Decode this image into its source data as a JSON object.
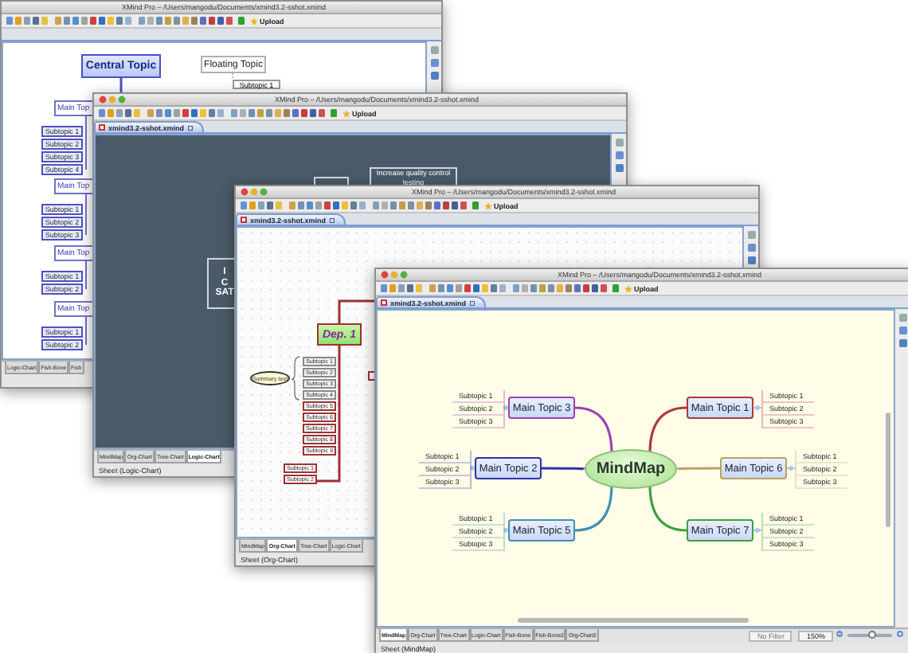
{
  "windows": [
    {
      "title": "XMind Pro – /Users/mangodu/Documents/xmind3.2-sshot.xmind",
      "upload": "Upload",
      "canvas": {
        "kind": "logic",
        "central": "Central Topic",
        "floating": "Floating Topic",
        "floating_child": "Subtopic 1",
        "branches": [
          {
            "label": "Main Top",
            "children": [
              "Subtopic 1",
              "Subtopic 2",
              "Subtopic 3",
              "Subtopic 4"
            ]
          },
          {
            "label": "Main Top",
            "children": [
              "Subtopic 1",
              "Subtopic 2",
              "Subtopic 3"
            ]
          },
          {
            "label": "Main Top",
            "children": [
              "Subtopic 1",
              "Subtopic 2"
            ]
          },
          {
            "label": "Main Top",
            "children": [
              "Subtopic 1",
              "Subtopic 2"
            ]
          }
        ]
      },
      "sheet_tabs": [
        {
          "label": "Logic-Chart",
          "selected": false
        },
        {
          "label": "Fish-Bone",
          "selected": false
        },
        {
          "label": "Fish",
          "selected": false
        }
      ]
    },
    {
      "title": "XMind Pro – /Users/mangodu/Documents/xmind3.2-sshot.xmind",
      "upload": "Upload",
      "tab": "xmind3.2-sshot.xmind",
      "canvas": {
        "kind": "dark",
        "node": "Increase quality control testing",
        "central_lines": [
          "I",
          "C",
          "SAT"
        ]
      },
      "sheet_tabs": [
        {
          "label": "MindMap",
          "selected": false
        },
        {
          "label": "Org-Chart",
          "selected": false
        },
        {
          "label": "Tree-Chart",
          "selected": false
        },
        {
          "label": "Logic-Chart",
          "selected": true
        }
      ],
      "status": "Sheet (Logic-Chart)"
    },
    {
      "title": "XMind Pro – /Users/mangodu/Documents/xmind3.2-sshot.xmind",
      "upload": "Upload",
      "tab": "xmind3.2-sshot.xmind",
      "canvas": {
        "kind": "org",
        "head": "Dep. 1",
        "summary": "Summary text",
        "subtopics": [
          {
            "label": "Subtopic 1",
            "color": "#888888"
          },
          {
            "label": "Subtopic 2",
            "color": "#888888"
          },
          {
            "label": "Subtopic 3",
            "color": "#888888"
          },
          {
            "label": "Subtopic 4",
            "color": "#888888"
          },
          {
            "label": "Subtopic 5",
            "color": "#a03030"
          },
          {
            "label": "Subtopic 6",
            "color": "#a03030"
          },
          {
            "label": "Subtopic 7",
            "color": "#a03030"
          },
          {
            "label": "Subtopic 8",
            "color": "#a03030"
          },
          {
            "label": "Subtopic 9",
            "color": "#a03030"
          }
        ],
        "extra": [
          "Subtopic 1",
          "Subtopic 2"
        ]
      },
      "sheet_tabs": [
        {
          "label": "MindMap",
          "selected": false
        },
        {
          "label": "Org-Chart",
          "selected": true
        },
        {
          "label": "Tree-Chart",
          "selected": false
        },
        {
          "label": "Logic-Chart",
          "selected": false
        }
      ],
      "status": "Sheet (Org-Chart)"
    },
    {
      "title": "XMind Pro – /Users/mangodu/Documents/xmind3.2-sshot.xmind",
      "upload": "Upload",
      "tab": "xmind3.2-sshot.xmind",
      "canvas": {
        "kind": "mindmap",
        "central": "MindMap",
        "branches": [
          {
            "label": "Main Topic 3",
            "color": "#a040b0",
            "children": [
              "Subtopic 1",
              "Subtopic 2",
              "Subtopic 3"
            ]
          },
          {
            "label": "Main Topic 1",
            "color": "#b03838",
            "children": [
              "Subtopic 1",
              "Subtopic 2",
              "Subtopic 3"
            ]
          },
          {
            "label": "Main Topic 2",
            "color": "#3030b0",
            "children": [
              "Subtopic 1",
              "Subtopic 2",
              "Subtopic 3"
            ]
          },
          {
            "label": "Main Topic 6",
            "color": "#c0a060",
            "children": [
              "Subtopic 1",
              "Subtopic 2",
              "Subtopic 3"
            ]
          },
          {
            "label": "Main Topic 5",
            "color": "#4090b0",
            "children": [
              "Subtopic 1",
              "Subtopic 2",
              "Subtopic 3"
            ]
          },
          {
            "label": "Main Topic 7",
            "color": "#40a040",
            "children": [
              "Subtopic 1",
              "Subtopic 2",
              "Subtopic 3"
            ]
          }
        ]
      },
      "sheet_tabs": [
        {
          "label": "MindMap",
          "selected": true
        },
        {
          "label": "Org-Chart",
          "selected": false
        },
        {
          "label": "Tree-Chart",
          "selected": false
        },
        {
          "label": "Logic-Chart",
          "selected": false
        },
        {
          "label": "Fish-Bone",
          "selected": false
        },
        {
          "label": "Fish-Bone2",
          "selected": false
        },
        {
          "label": "Org-Chart2",
          "selected": false
        }
      ],
      "filter": "No Filter",
      "zoom": "150%",
      "zoom_slider": {
        "level": 0.55
      },
      "status": "Sheet (MindMap)"
    }
  ]
}
